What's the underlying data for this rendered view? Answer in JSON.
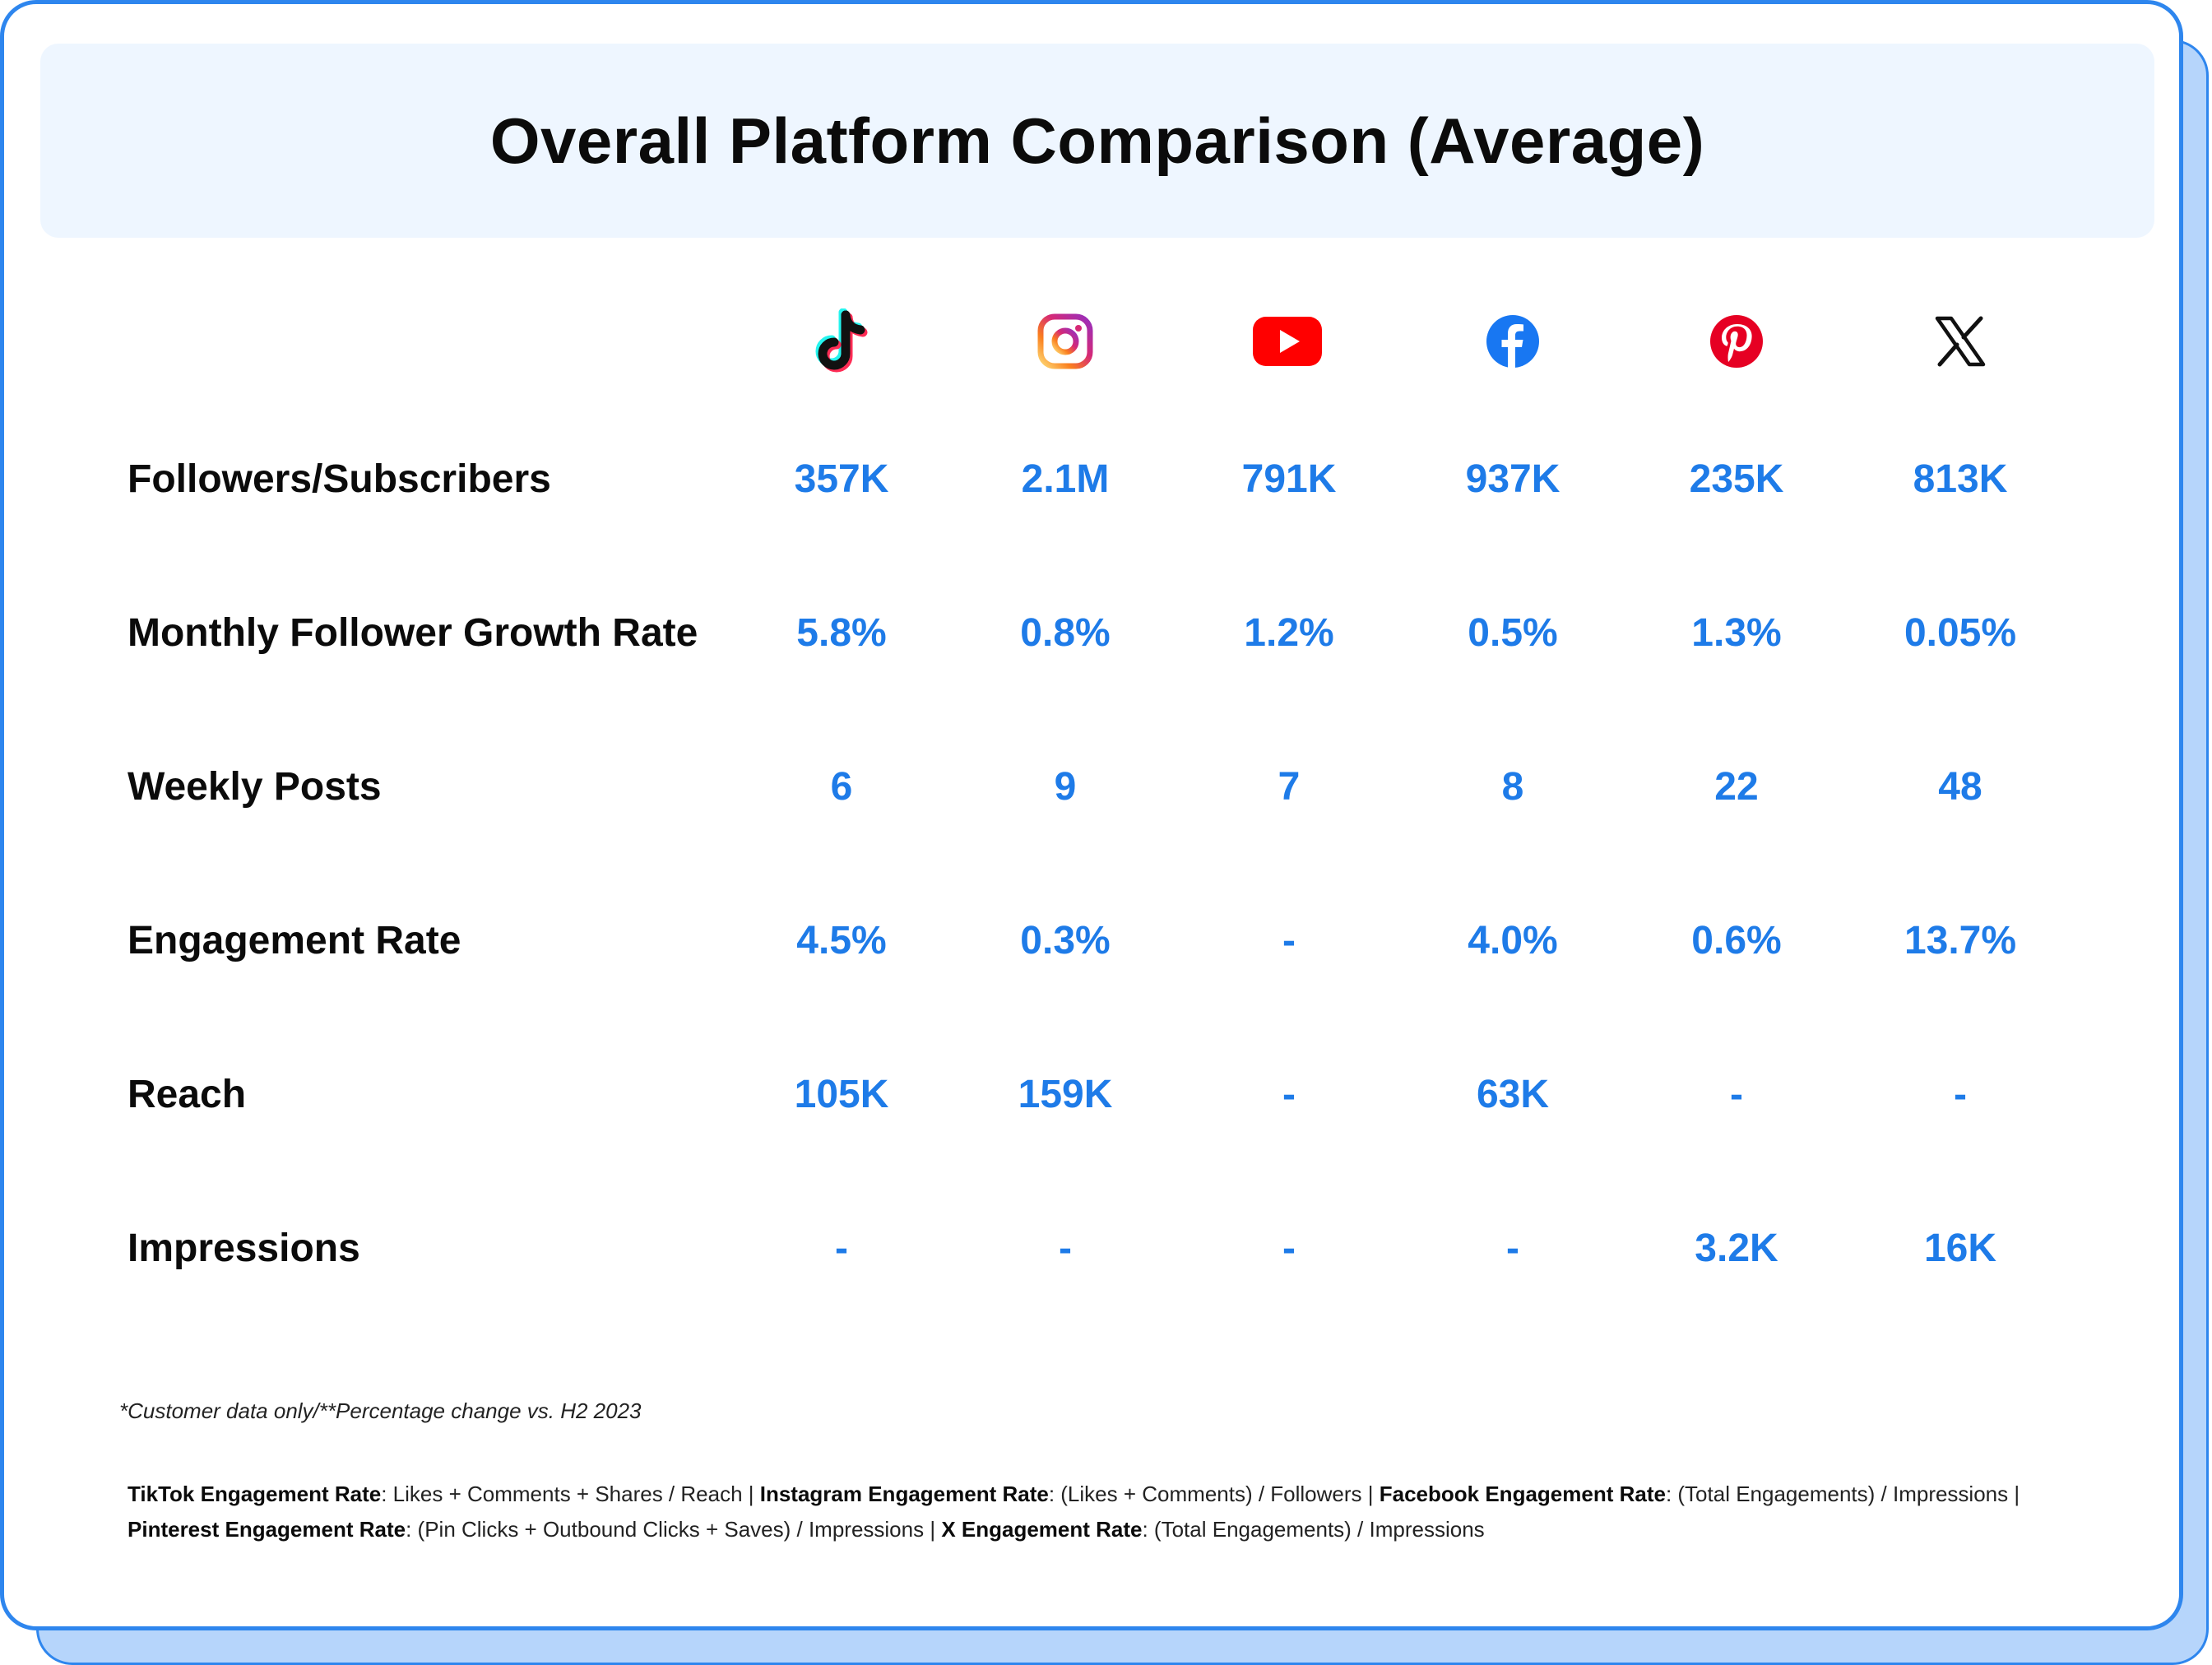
{
  "title": "Overall Platform Comparison (Average)",
  "platforms": [
    {
      "icon": "tiktok-icon"
    },
    {
      "icon": "instagram-icon"
    },
    {
      "icon": "youtube-icon"
    },
    {
      "icon": "facebook-icon"
    },
    {
      "icon": "pinterest-icon"
    },
    {
      "icon": "x-icon"
    }
  ],
  "rows": [
    {
      "label": "Followers/Subscribers",
      "values": [
        "357K",
        "2.1M",
        "791K",
        "937K",
        "235K",
        "813K"
      ]
    },
    {
      "label": "Monthly Follower Growth Rate",
      "values": [
        "5.8%",
        "0.8%",
        "1.2%",
        "0.5%",
        "1.3%",
        "0.05%"
      ]
    },
    {
      "label": "Weekly Posts",
      "values": [
        "6",
        "9",
        "7",
        "8",
        "22",
        "48"
      ]
    },
    {
      "label": "Engagement Rate",
      "values": [
        "4.5%",
        "0.3%",
        "-",
        "4.0%",
        "0.6%",
        "13.7%"
      ]
    },
    {
      "label": "Reach",
      "values": [
        "105K",
        "159K",
        "-",
        "63K",
        "-",
        "-"
      ]
    },
    {
      "label": "Impressions",
      "values": [
        "-",
        "-",
        "-",
        "-",
        "3.2K",
        "16K"
      ]
    }
  ],
  "footnote": "*Customer data only/**Percentage change vs. H2 2023",
  "definitions": [
    {
      "name": "TikTok Engagement Rate",
      "formula": ": Likes + Comments + Shares / Reach | "
    },
    {
      "name": "Instagram Engagement Rate",
      "formula": ": (Likes + Comments) / Followers | "
    },
    {
      "name": "Facebook Engagement Rate",
      "formula": ": (Total Engagements) / Impressions | "
    },
    {
      "name": "Pinterest Engagement Rate",
      "formula": ": (Pin Clicks + Outbound Clicks + Saves) / Impressions | "
    },
    {
      "name": "X Engagement Rate",
      "formula": ": (Total Engagements) / Impressions"
    }
  ],
  "colors": {
    "accent": "#1e7be8",
    "border": "#2e86ee",
    "title_band": "#eef6ff",
    "shadow": "#b6d5fb"
  }
}
